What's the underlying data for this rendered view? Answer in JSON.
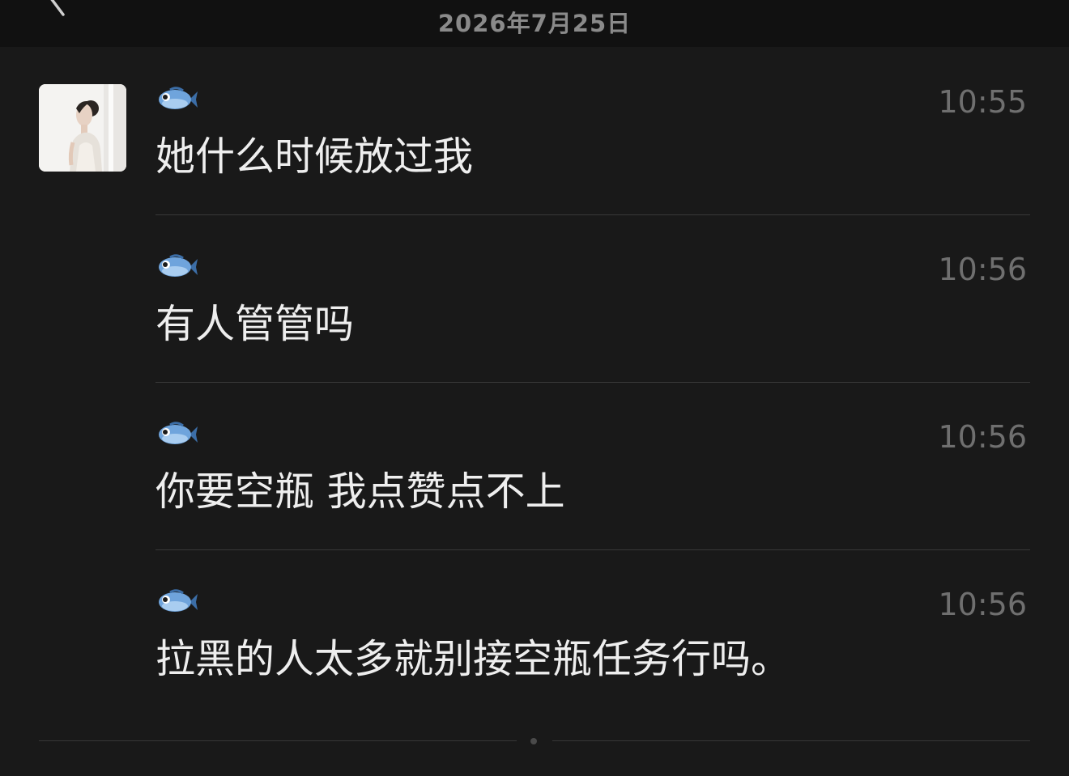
{
  "header": {
    "date": "2026年7月25日",
    "back_icon": "chevron-left-icon"
  },
  "sender": {
    "avatar_icon": "avatar-photo"
  },
  "messages": [
    {
      "sender_icon": "fish-icon",
      "time": "10:55",
      "text": "她什么时候放过我"
    },
    {
      "sender_icon": "fish-icon",
      "time": "10:56",
      "text": "有人管管吗"
    },
    {
      "sender_icon": "fish-icon",
      "time": "10:56",
      "text": "你要空瓶 我点赞点不上"
    },
    {
      "sender_icon": "fish-icon",
      "time": "10:56",
      "text": "拉黑的人太多就别接空瓶任务行吗。"
    }
  ],
  "colors": {
    "background": "#191919",
    "header_background": "#111111",
    "message_text": "#eeeeee",
    "time_text": "#6f6f6f",
    "divider": "#383838",
    "fish_blue": "#6fa4dc"
  }
}
